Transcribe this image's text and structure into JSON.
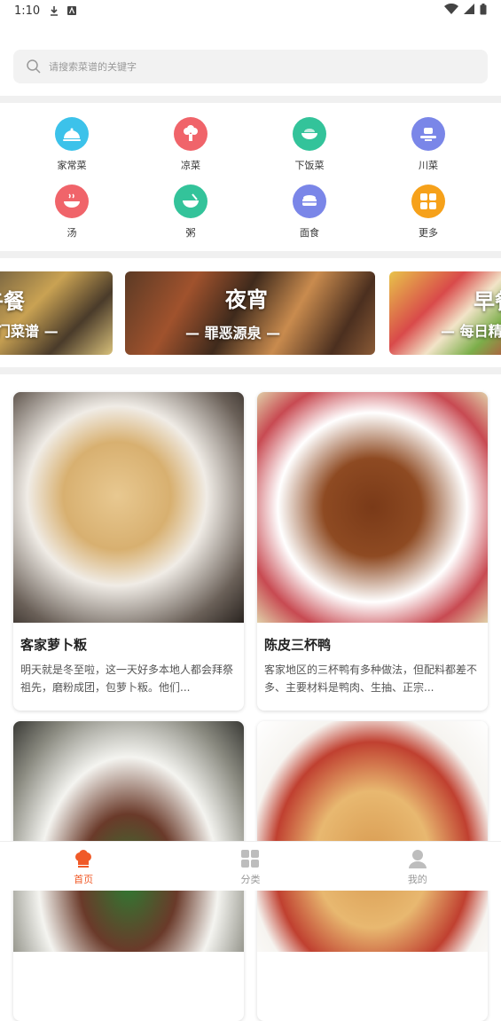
{
  "status_bar": {
    "time": "1:10"
  },
  "search": {
    "placeholder": "请搜索菜谱的关键字"
  },
  "categories": [
    {
      "label": "家常菜",
      "color": "#3cc2ea",
      "icon": "cloche-icon"
    },
    {
      "label": "凉菜",
      "color": "#f0646a",
      "icon": "broccoli-icon"
    },
    {
      "label": "下饭菜",
      "color": "#33c39a",
      "icon": "rice-bowl-icon"
    },
    {
      "label": "川菜",
      "color": "#7a86e8",
      "icon": "dish-icon"
    },
    {
      "label": "汤",
      "color": "#f0646a",
      "icon": "soup-icon"
    },
    {
      "label": "粥",
      "color": "#33c39a",
      "icon": "porridge-icon"
    },
    {
      "label": "面食",
      "color": "#7a86e8",
      "icon": "steamer-icon"
    },
    {
      "label": "更多",
      "color": "#f6a11a",
      "icon": "grid-more-icon"
    }
  ],
  "banners": [
    {
      "title": "午餐",
      "subtitle": "热门菜谱 —"
    },
    {
      "title": "夜宵",
      "subtitle": "— 罪恶源泉 —"
    },
    {
      "title": "早餐",
      "subtitle": "— 每日精选"
    }
  ],
  "recipes": [
    {
      "title": "客家萝卜粄",
      "desc": "明天就是冬至啦，这一天好多本地人都会拜祭祖先，磨粉成团，包萝卜粄。他们..."
    },
    {
      "title": "陈皮三杯鸭",
      "desc": "客家地区的三杯鸭有多种做法，但配料都差不多、主要材料是鸭肉、生抽、正宗..."
    },
    {
      "title": "",
      "desc": ""
    },
    {
      "title": "",
      "desc": ""
    }
  ],
  "nav": [
    {
      "label": "首页",
      "icon": "chef-hat-icon",
      "active": true
    },
    {
      "label": "分类",
      "icon": "grid-icon",
      "active": false
    },
    {
      "label": "我的",
      "icon": "user-icon",
      "active": false
    }
  ],
  "colors": {
    "accent": "#f05a28"
  }
}
